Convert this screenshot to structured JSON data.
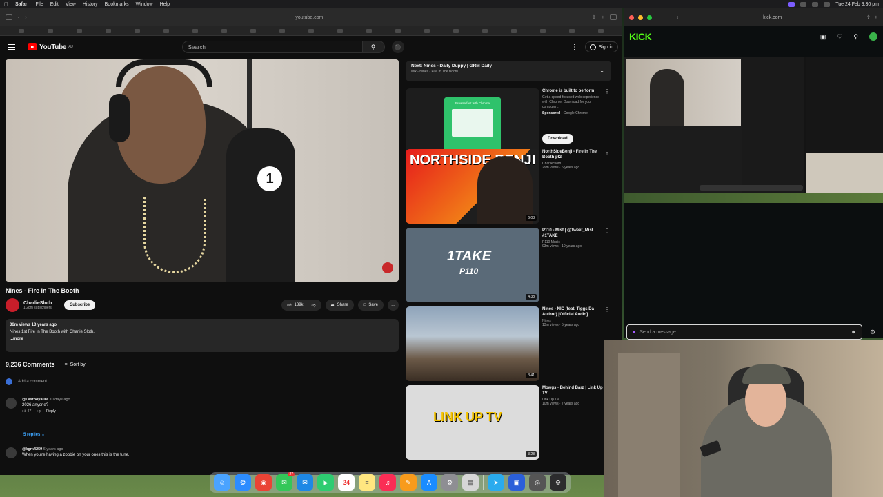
{
  "menubar": {
    "app": "Safari",
    "items": [
      "File",
      "Edit",
      "View",
      "History",
      "Bookmarks",
      "Window",
      "Help"
    ],
    "clock": "Tue 24 Feb  9:30 pm"
  },
  "safari": {
    "url": "youtube.com"
  },
  "youtube": {
    "logo": "YouTube",
    "logo_region": "AU",
    "search_placeholder": "Search",
    "sign_in": "Sign in",
    "video_title": "Nines - Fire In The Booth",
    "channel_name": "CharlieSloth",
    "channel_subs": "1.28m subscribers",
    "subscribe": "Subscribe",
    "likes": "139k",
    "share": "Share",
    "save": "Save",
    "desc_stats": "36m views  13 years ago",
    "desc_text": "Nines 1st Fire In The Booth with Charlie Sloth.",
    "desc_more": "...more",
    "comments_count": "9,236 Comments",
    "sort_by": "Sort by",
    "add_comment": "Add a comment...",
    "comments": [
      {
        "handle": "@Lastboyaura",
        "age": "10 days ago",
        "text": "2026 anyone?",
        "likes": "47",
        "reply": "Reply"
      },
      {
        "handle": "@kgrk4259",
        "age": "6 years ago",
        "text": "When you're having a zoobie on your ones this is the tune."
      }
    ],
    "replies": "5 replies",
    "next": {
      "title": "Next: Nines - Daily Duppy | GRM Daily",
      "sub": "Mix - Nines - Fire In The Booth"
    },
    "ad": {
      "title": "Chrome is built to perform",
      "desc": "Get a speed-focused web experience with Chrome. Download for your computer...",
      "sponsored": "Sponsored",
      "advertiser": "Google Chrome",
      "button": "Download",
      "thumb_text": "Browse fast with Chrome"
    },
    "recs": [
      {
        "title": "NorthSideBenji - Fire In The Booth pt2",
        "channel": "CharlieSloth",
        "stats": "29m views · 6 years ago",
        "duration": "6:08",
        "thumb_text": "NORTHSIDE BENJI"
      },
      {
        "title": "P110 - Mist | @Tweet_Mist #1TAKE",
        "channel": "P110 Music",
        "stats": "93m views · 10 years ago",
        "duration": "4:38",
        "thumb_text": "1TAKE",
        "thumb_sub": "P110"
      },
      {
        "title": "Nines - NIC (feat. Tiggs Da Author) [Official Audio]",
        "channel": "Nines",
        "stats": "13m views · 5 years ago",
        "duration": "3:41"
      },
      {
        "title": "Mowgs - Behind Barz | Link Up TV",
        "channel": "Link Up TV",
        "stats": "10m views · 7 years ago",
        "duration": "3:28",
        "thumb_text": "LINK UP TV"
      }
    ]
  },
  "kick": {
    "url": "kick.com",
    "logo": "KICK",
    "chat_placeholder": "Send a message"
  },
  "dock": {
    "messages_badge": "27",
    "calendar_day": "24"
  },
  "colors": {
    "yt_red": "#ff0000",
    "kick_green": "#53fc18"
  }
}
